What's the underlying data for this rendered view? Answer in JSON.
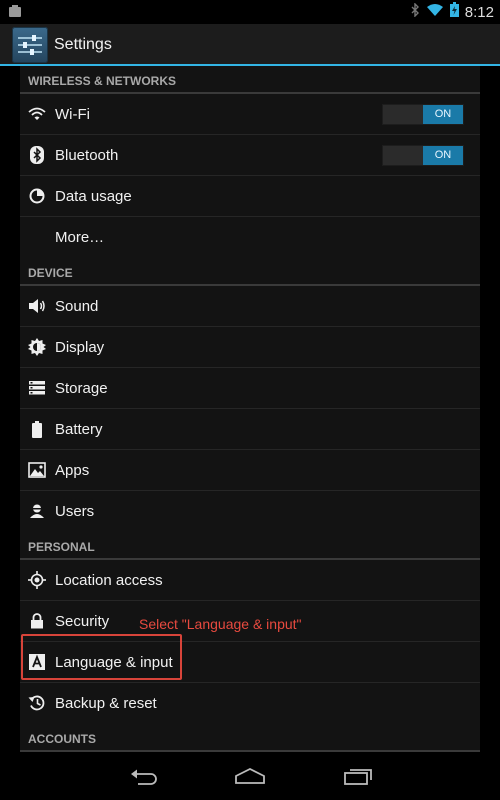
{
  "status_bar": {
    "time": "8:12",
    "icons": [
      "notification-icon",
      "bluetooth-icon",
      "wifi-icon",
      "battery-icon"
    ]
  },
  "action_bar": {
    "title": "Settings",
    "app_icon": "settings-sliders-icon",
    "accent_color": "#33b5e5"
  },
  "sections": {
    "wireless": {
      "header": "WIRELESS & NETWORKS",
      "items": [
        {
          "label": "Wi-Fi",
          "icon": "wifi-icon",
          "toggle": "ON"
        },
        {
          "label": "Bluetooth",
          "icon": "bluetooth-icon",
          "toggle": "ON"
        },
        {
          "label": "Data usage",
          "icon": "data-usage-icon"
        },
        {
          "label": "More…"
        }
      ]
    },
    "device": {
      "header": "DEVICE",
      "items": [
        {
          "label": "Sound",
          "icon": "speaker-icon"
        },
        {
          "label": "Display",
          "icon": "brightness-icon"
        },
        {
          "label": "Storage",
          "icon": "storage-icon"
        },
        {
          "label": "Battery",
          "icon": "battery-icon"
        },
        {
          "label": "Apps",
          "icon": "apps-icon"
        },
        {
          "label": "Users",
          "icon": "user-icon"
        }
      ]
    },
    "personal": {
      "header": "PERSONAL",
      "items": [
        {
          "label": "Location access",
          "icon": "location-icon"
        },
        {
          "label": "Security",
          "icon": "lock-icon"
        },
        {
          "label": "Language & input",
          "icon": "keyboard-a-icon"
        },
        {
          "label": "Backup & reset",
          "icon": "backup-icon"
        }
      ]
    },
    "accounts": {
      "header": "ACCOUNTS"
    }
  },
  "annotation": {
    "text": "Select \"Language & input\"",
    "color": "#e84a3f"
  },
  "nav_bar": {
    "buttons": [
      "back-icon",
      "home-icon",
      "recents-icon"
    ]
  }
}
